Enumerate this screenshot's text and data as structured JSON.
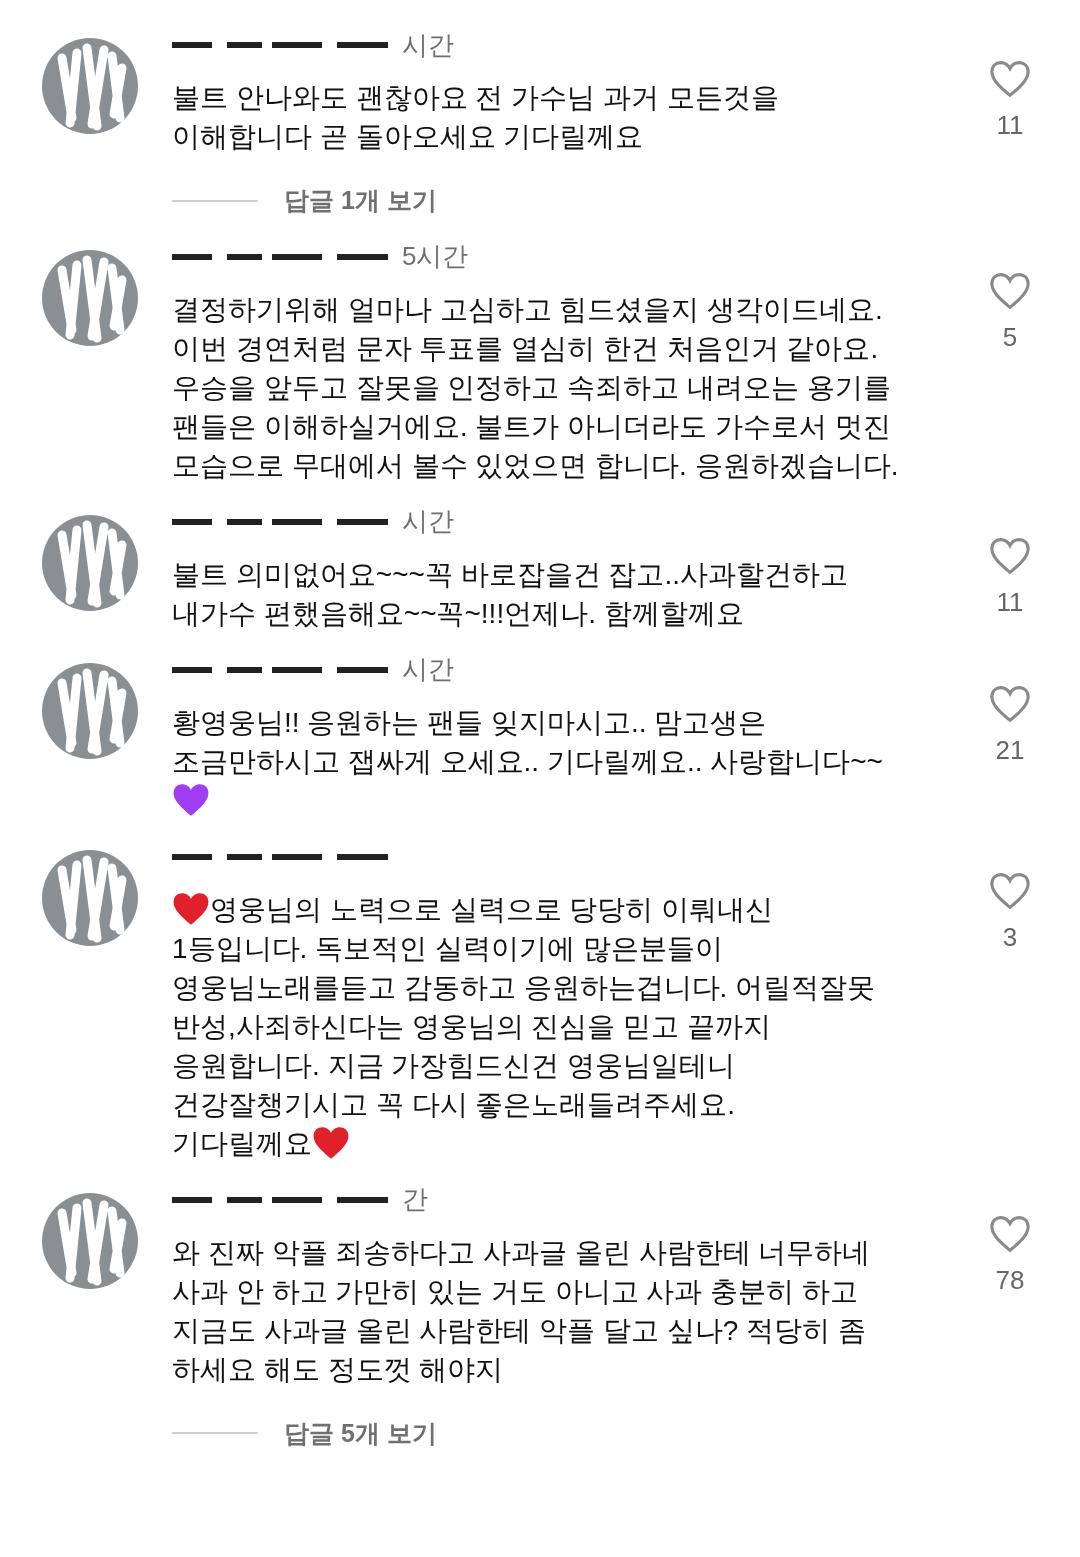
{
  "comments": [
    {
      "time": "시간",
      "likes": "11",
      "lines": [
        [
          {
            "kind": "text",
            "text": "불트 안나와도 괜찮아요 전 가수님 과거 모든것을"
          }
        ],
        [
          {
            "kind": "text",
            "text": "이해합니다 곧 돌아오세요 기다릴께요"
          }
        ]
      ],
      "replies": "답글 1개 보기"
    },
    {
      "time": "5시간",
      "likes": "5",
      "lines": [
        [
          {
            "kind": "text",
            "text": "결정하기위해 얼마나 고심하고 힘드셨을지 생각이드네요."
          }
        ],
        [
          {
            "kind": "text",
            "text": "이번 경연처럼 문자 투표를 열심히 한건 처음인거 같아요."
          }
        ],
        [
          {
            "kind": "text",
            "text": "우승을 앞두고 잘못을 인정하고 속죄하고 내려오는 용기를"
          }
        ],
        [
          {
            "kind": "text",
            "text": "팬들은 이해하실거에요. 불트가 아니더라도 가수로서 멋진"
          }
        ],
        [
          {
            "kind": "text",
            "text": "모습으로 무대에서 볼수 있었으면 합니다. 응원하겠습니다."
          }
        ]
      ]
    },
    {
      "time": "시간",
      "likes": "11",
      "lines": [
        [
          {
            "kind": "text",
            "text": "불트 의미없어요~~~꼭 바로잡을건 잡고..사과할건하고"
          }
        ],
        [
          {
            "kind": "text",
            "text": "내가수 편했음해요~~꼭~!!!언제나. 함께할께요"
          }
        ]
      ]
    },
    {
      "time": "시간",
      "likes": "21",
      "lines": [
        [
          {
            "kind": "text",
            "text": "황영웅님!! 응원하는 팬들 잊지마시고.. 맘고생은"
          }
        ],
        [
          {
            "kind": "text",
            "text": "조금만하시고  잽싸게 오세요.. 기다릴께요.. 사랑합니다~~"
          }
        ],
        [
          {
            "kind": "emoji",
            "color": "#a13df0"
          }
        ]
      ]
    },
    {
      "likes": "3",
      "lines": [
        [
          {
            "kind": "emoji",
            "color": "#e0202a"
          },
          {
            "kind": "text",
            "text": "영웅님의 노력으로 실력으로 당당히 이뤄내신"
          }
        ],
        [
          {
            "kind": "text",
            "text": "1등입니다. 독보적인 실력이기에 많은분들이"
          }
        ],
        [
          {
            "kind": "text",
            "text": "영웅님노래를듣고 감동하고 응원하는겁니다. 어릴적잘못"
          }
        ],
        [
          {
            "kind": "text",
            "text": "반성,사죄하신다는 영웅님의 진심을 믿고 끝까지"
          }
        ],
        [
          {
            "kind": "text",
            "text": "응원합니다. 지금 가장힘드신건 영웅님일테니"
          }
        ],
        [
          {
            "kind": "text",
            "text": "건강잘챙기시고 꼭 다시 좋은노래들려주세요."
          }
        ],
        [
          {
            "kind": "text",
            "text": "기다릴께요"
          },
          {
            "kind": "emoji",
            "color": "#e0202a"
          }
        ]
      ]
    },
    {
      "time": "간",
      "likes": "78",
      "lines": [
        [
          {
            "kind": "text",
            "text": "와 진짜 악플 죄송하다고 사과글 올린 사람한테 너무하네"
          }
        ],
        [
          {
            "kind": "text",
            "text": "사과 안 하고 가만히 있는 거도 아니고 사과 충분히 하고"
          }
        ],
        [
          {
            "kind": "text",
            "text": "지금도 사과글 올린 사람한테 악플 달고 싶나? 적당히 좀"
          }
        ],
        [
          {
            "kind": "text",
            "text": "하세요  해도 정도껏 해야지"
          }
        ]
      ],
      "replies": "답글 5개 보기"
    }
  ]
}
